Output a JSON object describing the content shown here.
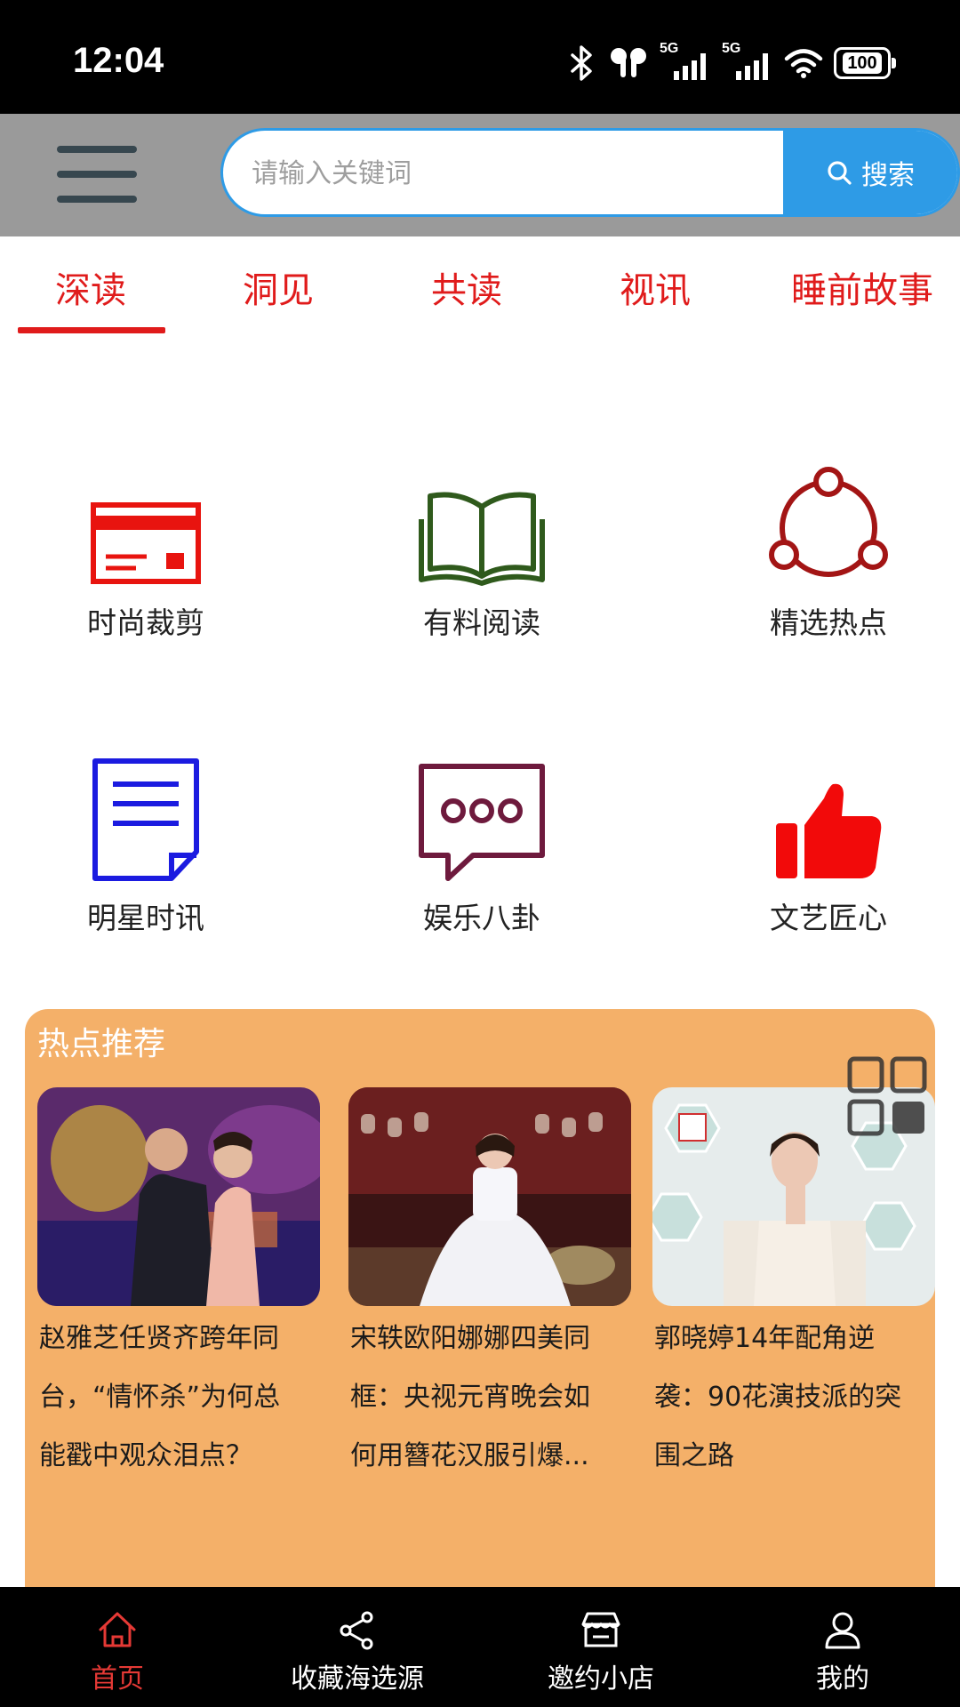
{
  "status_bar": {
    "time": "12:04",
    "network_1": "5G",
    "network_2": "5G",
    "battery": "100",
    "icons": [
      "bluetooth-icon",
      "earbuds-icon",
      "signal-icon",
      "signal-icon",
      "wifi-icon",
      "battery-icon"
    ]
  },
  "search": {
    "placeholder": "请输入关键词",
    "button_label": "搜索",
    "accent": "#2e9be6"
  },
  "tabs": [
    {
      "label": "深读",
      "active": true
    },
    {
      "label": "洞见"
    },
    {
      "label": "共读"
    },
    {
      "label": "视讯"
    },
    {
      "label": "睡前故事"
    }
  ],
  "categories": [
    {
      "label": "时尚裁剪",
      "icon": "card-icon",
      "color": "#e8140f"
    },
    {
      "label": "有料阅读",
      "icon": "open-book-icon",
      "color": "#2f5a1c"
    },
    {
      "label": "精选热点",
      "icon": "share-nodes-icon",
      "color": "#a31515"
    },
    {
      "label": "明星时讯",
      "icon": "document-icon",
      "color": "#1b1be0"
    },
    {
      "label": "娱乐八卦",
      "icon": "chat-bubble-icon",
      "color": "#6e1a3d"
    },
    {
      "label": "文艺匠心",
      "icon": "thumbs-up-icon",
      "color": "#f20a0a"
    }
  ],
  "hot": {
    "title": "热点推荐",
    "background": "#f4b069",
    "cards": [
      {
        "caption_lines": [
          "赵雅芝任贤齐跨年同",
          "台，“情怀杀”为何总",
          "能戳中观众泪点？"
        ]
      },
      {
        "caption_lines": [
          "宋轶欧阳娜娜四美同",
          "框：央视元宵晚会如",
          "何用簪花汉服引爆..."
        ]
      },
      {
        "caption_lines": [
          "郭晓婷14年配角逆",
          "袭：90花演技派的突",
          "围之路"
        ]
      }
    ]
  },
  "bottom_nav": [
    {
      "label": "首页",
      "icon": "home-icon",
      "active": true
    },
    {
      "label": "收藏海选源",
      "icon": "share-icon"
    },
    {
      "label": "邀约小店",
      "icon": "store-icon"
    },
    {
      "label": "我的",
      "icon": "person-icon"
    }
  ]
}
